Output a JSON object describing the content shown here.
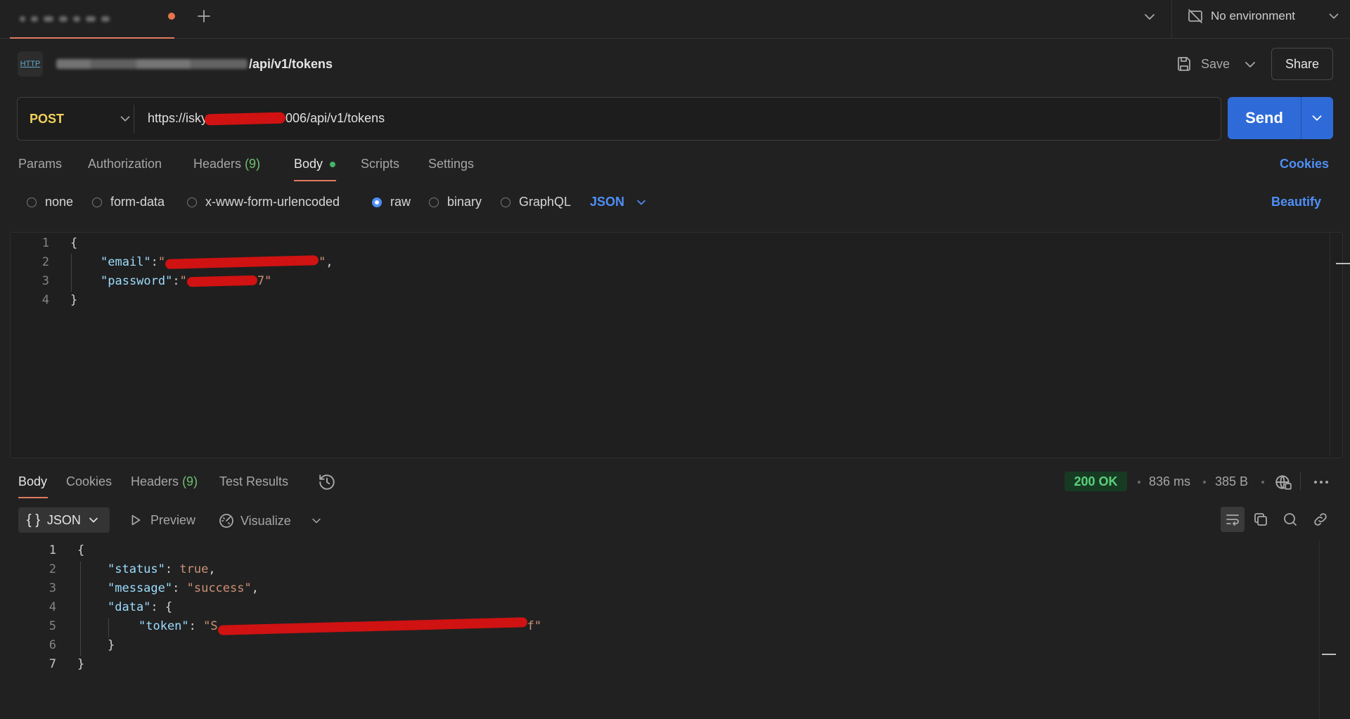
{
  "tabs": {
    "new_tab_icon": "plus-icon",
    "dropdown_icon": "chevron-down-icon"
  },
  "environment": {
    "label": "No environment",
    "icon": "no-environment-icon"
  },
  "request": {
    "badge": "HTTP",
    "title_path": "/api/v1/tokens",
    "save_label": "Save",
    "share_label": "Share",
    "method": "POST",
    "url_prefix": "https://isky",
    "url_suffix": "006/api/v1/tokens",
    "send_label": "Send"
  },
  "request_tabs": {
    "params": "Params",
    "authorization": "Authorization",
    "headers": "Headers",
    "headers_count": "(9)",
    "body": "Body",
    "scripts": "Scripts",
    "settings": "Settings",
    "cookies": "Cookies"
  },
  "body_types": {
    "none": "none",
    "form_data": "form-data",
    "urlencoded": "x-www-form-urlencoded",
    "raw": "raw",
    "binary": "binary",
    "graphql": "GraphQL",
    "language": "JSON",
    "beautify": "Beautify",
    "selected": "raw"
  },
  "request_body": {
    "line_numbers": [
      "1",
      "2",
      "3",
      "4"
    ],
    "open_brace": "{",
    "email_key": "\"email\"",
    "password_key": "\"password\"",
    "close_brace": "}"
  },
  "response_tabs": {
    "body": "Body",
    "cookies": "Cookies",
    "headers": "Headers",
    "headers_count": "(9)",
    "test_results": "Test Results"
  },
  "response_meta": {
    "status": "200 OK",
    "time": "836 ms",
    "size": "385 B",
    "status_color": "#5bd17c"
  },
  "response_toolbar": {
    "format": "JSON",
    "preview": "Preview",
    "visualize": "Visualize"
  },
  "response_body": {
    "line_numbers": [
      "1",
      "2",
      "3",
      "4",
      "5",
      "6",
      "7"
    ],
    "status_key": "\"status\"",
    "status_value": "true",
    "message_key": "\"message\"",
    "message_value": "\"success\"",
    "data_key": "\"data\"",
    "token_key": "\"token\""
  }
}
